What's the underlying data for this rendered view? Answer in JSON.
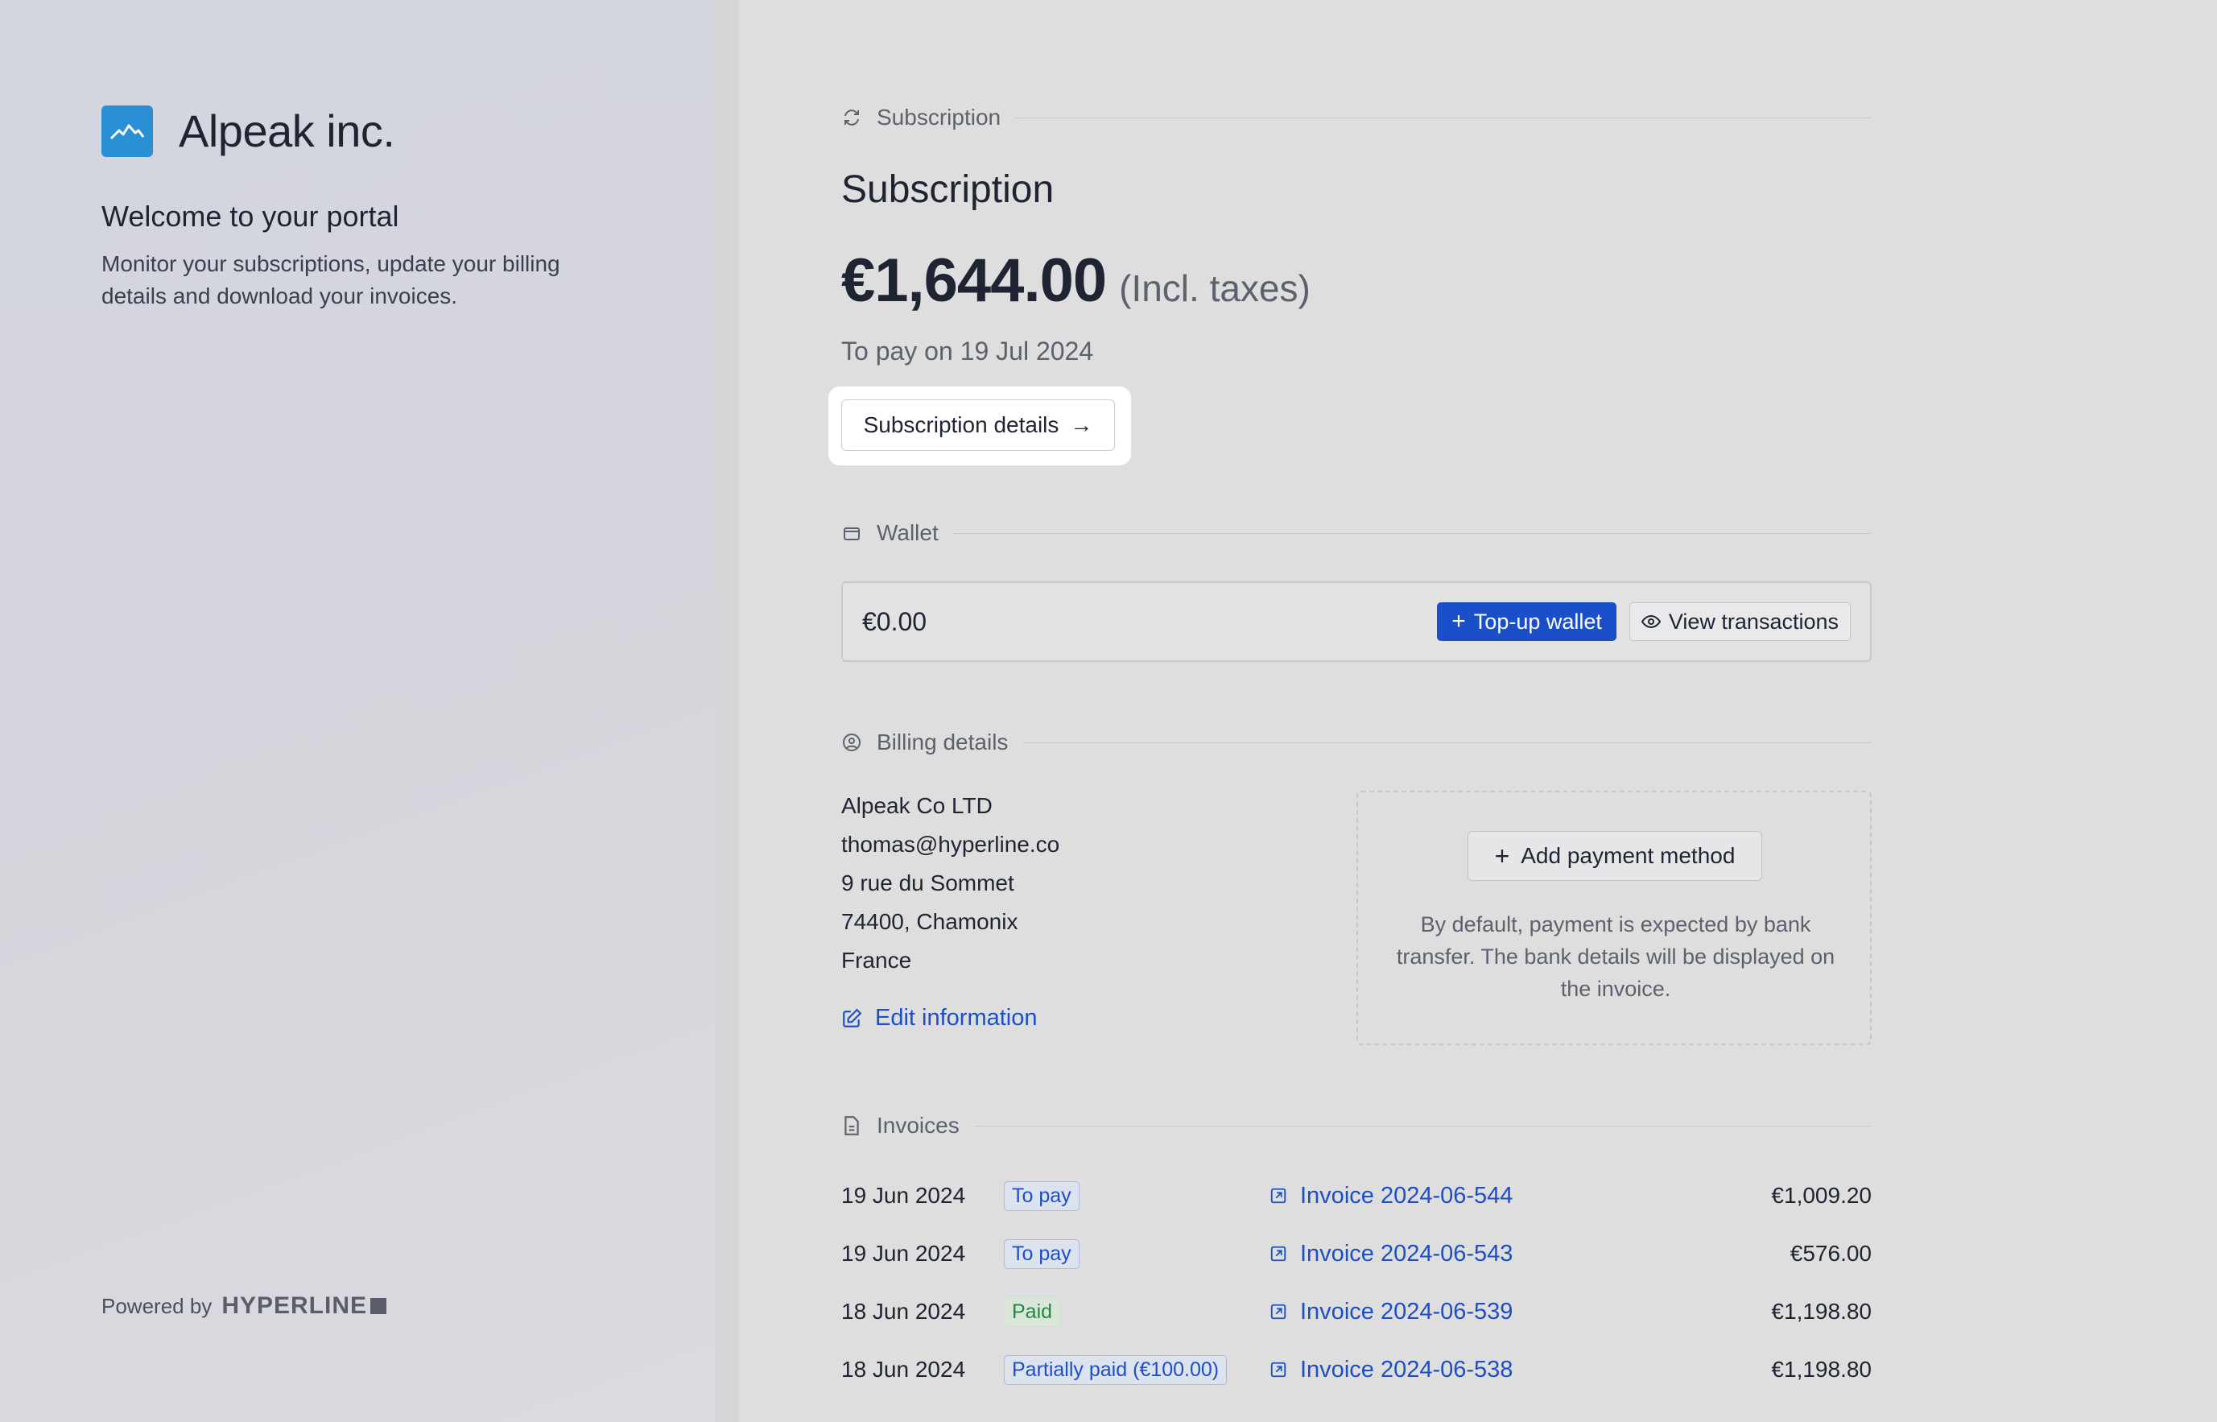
{
  "brand": {
    "name": "Alpeak inc.",
    "logo_icon": "mountain-icon",
    "logo_color": "#2b8fd6"
  },
  "welcome": {
    "title": "Welcome to your portal",
    "description": "Monitor your subscriptions, update your billing details and download your invoices."
  },
  "footer": {
    "powered_by": "Powered by",
    "vendor": "HYPERLINE"
  },
  "subscription": {
    "section_label": "Subscription",
    "title": "Subscription",
    "amount": "€1,644.00",
    "tax_note": "(Incl. taxes)",
    "due": "To pay on 19 Jul 2024",
    "details_button": "Subscription details"
  },
  "wallet": {
    "section_label": "Wallet",
    "balance": "€0.00",
    "topup_button": "Top-up wallet",
    "view_button": "View transactions",
    "accent": "#1a4fc9"
  },
  "billing": {
    "section_label": "Billing details",
    "company": "Alpeak Co LTD",
    "email": "thomas@hyperline.co",
    "street": "9 rue du Sommet",
    "city": "74400, Chamonix",
    "country": "France",
    "edit_link": "Edit information",
    "add_payment_button": "Add payment method",
    "payment_note": "By default, payment is expected by bank transfer. The bank details will be displayed on the invoice."
  },
  "invoices": {
    "section_label": "Invoices",
    "rows": [
      {
        "date": "19 Jun 2024",
        "status": "To pay",
        "number": "Invoice 2024-06-544",
        "amount": "€1,009.20"
      },
      {
        "date": "19 Jun 2024",
        "status": "To pay",
        "number": "Invoice 2024-06-543",
        "amount": "€576.00"
      },
      {
        "date": "18 Jun 2024",
        "status": "Paid",
        "number": "Invoice 2024-06-539",
        "amount": "€1,198.80"
      },
      {
        "date": "18 Jun 2024",
        "status": "Partially paid (€100.00)",
        "number": "Invoice 2024-06-538",
        "amount": "€1,198.80"
      }
    ]
  }
}
